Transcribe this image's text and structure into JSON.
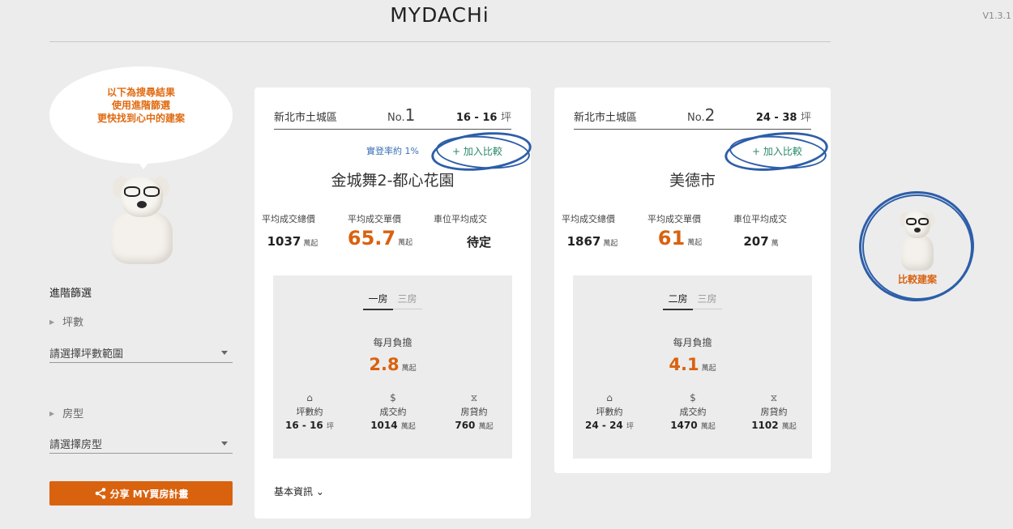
{
  "app": {
    "logo": "MYDACHi",
    "version": "V1.3.1"
  },
  "sidebar": {
    "bubble_lines": [
      "以下為搜尋結果",
      "使用進階篩選",
      "更快找到心中的建案"
    ],
    "filter_title": "進階篩選",
    "ping_label": "坪數",
    "ping_select_placeholder": "請選擇坪數範圍",
    "type_label": "房型",
    "type_select_placeholder": "請選擇房型",
    "share_button": "分享 MY買房計畫"
  },
  "cards": [
    {
      "district": "新北市土城區",
      "no_prefix": "No.",
      "no_num": "1",
      "ping_range": "16 - 16",
      "ping_unit": "坪",
      "rate_text": "實登率約 1%",
      "add_compare": "+ 加入比較",
      "project_name": "金城舞2-都心花園",
      "stats": {
        "total_label": "平均成交總價",
        "total_value": "1037",
        "total_unit": "萬起",
        "unit_label": "平均成交單價",
        "unit_value": "65.7",
        "unit_unit": "萬起",
        "parking_label": "車位平均成交",
        "parking_value": "待定",
        "parking_unit": ""
      },
      "tabs": [
        "一房",
        "三房"
      ],
      "monthly_label": "每月負擔",
      "monthly_value": "2.8",
      "monthly_unit": "萬起",
      "mini": [
        {
          "icon": "⌂",
          "label": "坪數約",
          "value": "16 - 16",
          "unit": "坪"
        },
        {
          "icon": "$",
          "label": "成交約",
          "value": "1014",
          "unit": "萬起"
        },
        {
          "icon": "⧖",
          "label": "房貸約",
          "value": "760",
          "unit": "萬起"
        }
      ],
      "basic_info": "基本資訊"
    },
    {
      "district": "新北市土城區",
      "no_prefix": "No.",
      "no_num": "2",
      "ping_range": "24 - 38",
      "ping_unit": "坪",
      "add_compare": "+ 加入比較",
      "project_name": "美德市",
      "stats": {
        "total_label": "平均成交總價",
        "total_value": "1867",
        "total_unit": "萬起",
        "unit_label": "平均成交單價",
        "unit_value": "61",
        "unit_unit": "萬起",
        "parking_label": "車位平均成交",
        "parking_value": "207",
        "parking_unit": "萬"
      },
      "tabs": [
        "二房",
        "三房"
      ],
      "monthly_label": "每月負擔",
      "monthly_value": "4.1",
      "monthly_unit": "萬起",
      "mini": [
        {
          "icon": "⌂",
          "label": "坪數約",
          "value": "24 - 24",
          "unit": "坪"
        },
        {
          "icon": "$",
          "label": "成交約",
          "value": "1470",
          "unit": "萬起"
        },
        {
          "icon": "⧖",
          "label": "房貸約",
          "value": "1102",
          "unit": "萬起"
        }
      ]
    }
  ],
  "compare_float": {
    "label": "比較建案"
  },
  "colors": {
    "accent": "#d9620f",
    "circle": "#2d5ea8",
    "link": "#2a8a6a"
  }
}
